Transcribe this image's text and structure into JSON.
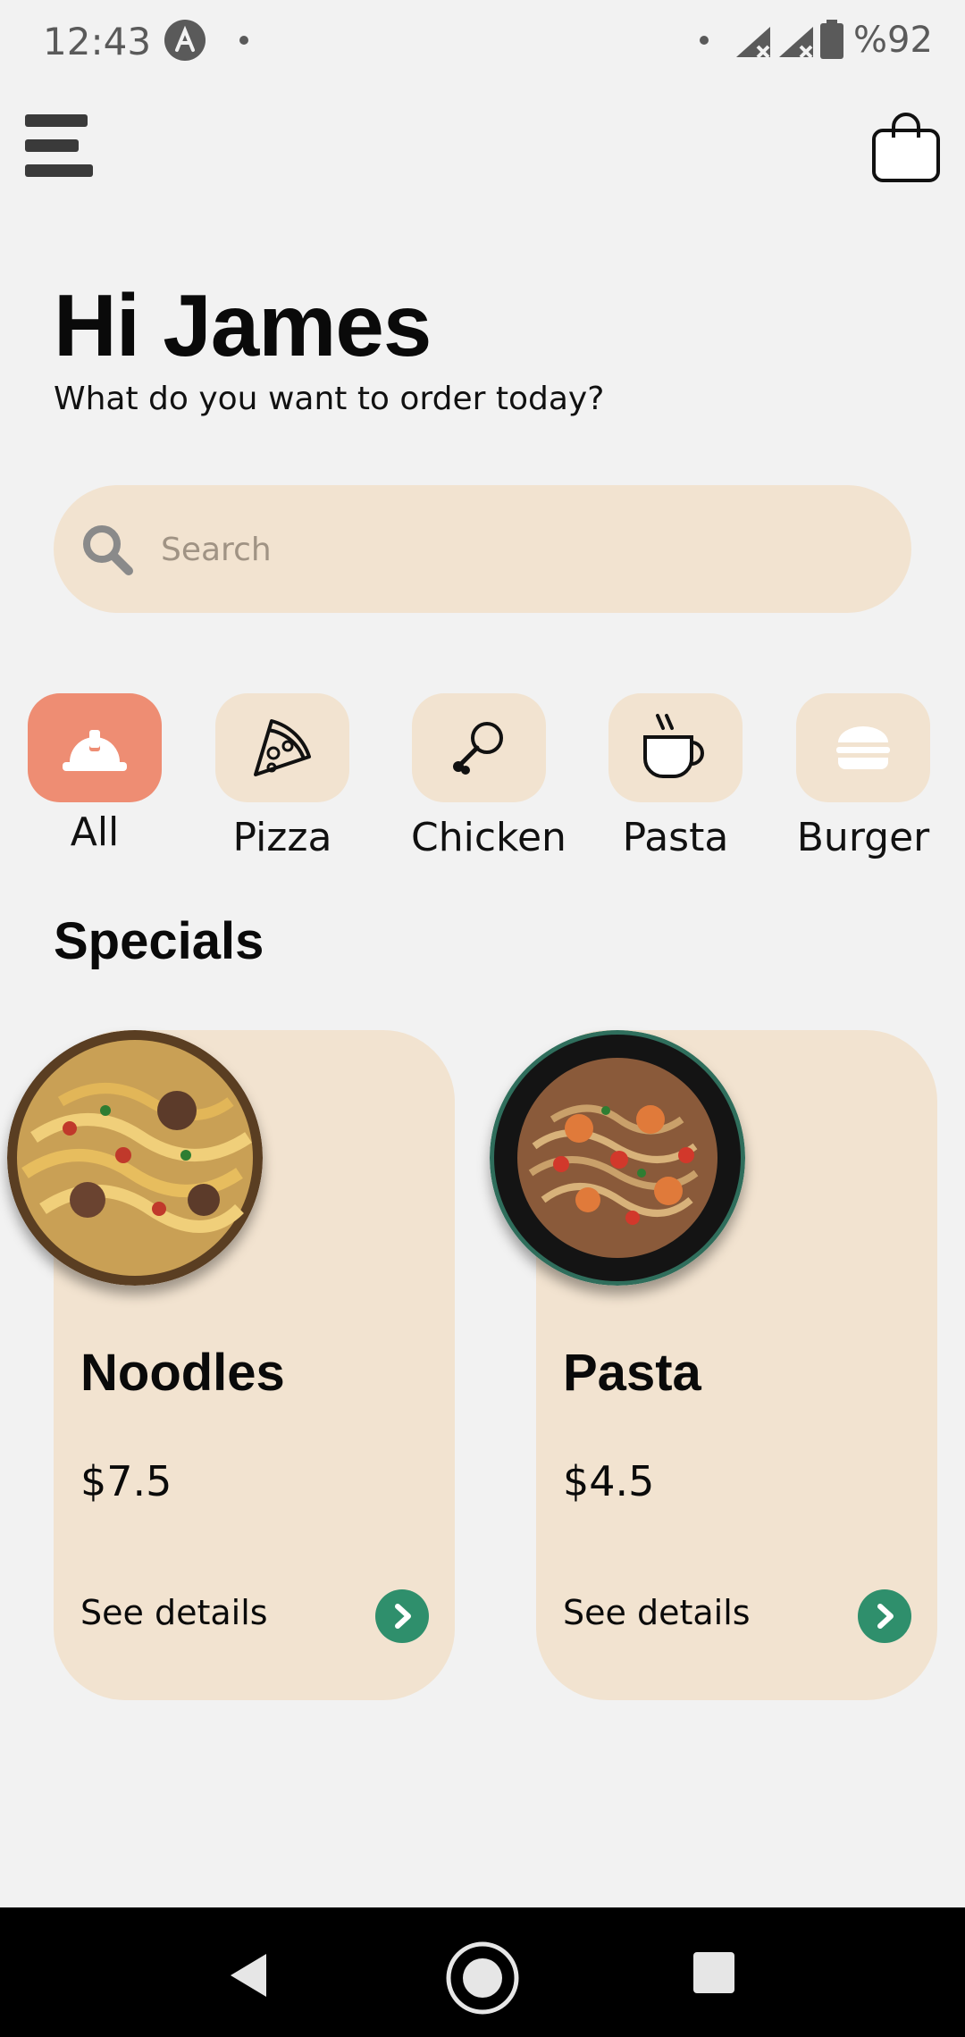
{
  "status_bar": {
    "time": "12:43",
    "battery": "%92"
  },
  "header": {
    "menu_icon": "hamburger-menu-icon",
    "cart_icon": "shopping-bag-icon"
  },
  "greeting": {
    "title": "Hi James",
    "subtitle": "What do you want to order today?"
  },
  "search": {
    "placeholder": "Search",
    "icon": "search-icon"
  },
  "categories": [
    {
      "label": "All",
      "icon": "helmet-icon",
      "active": true
    },
    {
      "label": "Pizza",
      "icon": "pizza-slice-icon",
      "active": false
    },
    {
      "label": "Chicken",
      "icon": "drumstick-icon",
      "active": false
    },
    {
      "label": "Pasta",
      "icon": "coffee-cup-icon",
      "active": false
    },
    {
      "label": "Burger",
      "icon": "burger-icon",
      "active": false
    }
  ],
  "specials": {
    "title": "Specials",
    "items": [
      {
        "name": "Noodles",
        "price": "$7.5",
        "details_label": "See details"
      },
      {
        "name": "Pasta",
        "price": "$4.5",
        "details_label": "See details"
      }
    ]
  },
  "colors": {
    "background": "#f2f2f2",
    "tile": "#f2e3d0",
    "accent": "#ee8d73",
    "arrow": "#2f8f6c"
  }
}
